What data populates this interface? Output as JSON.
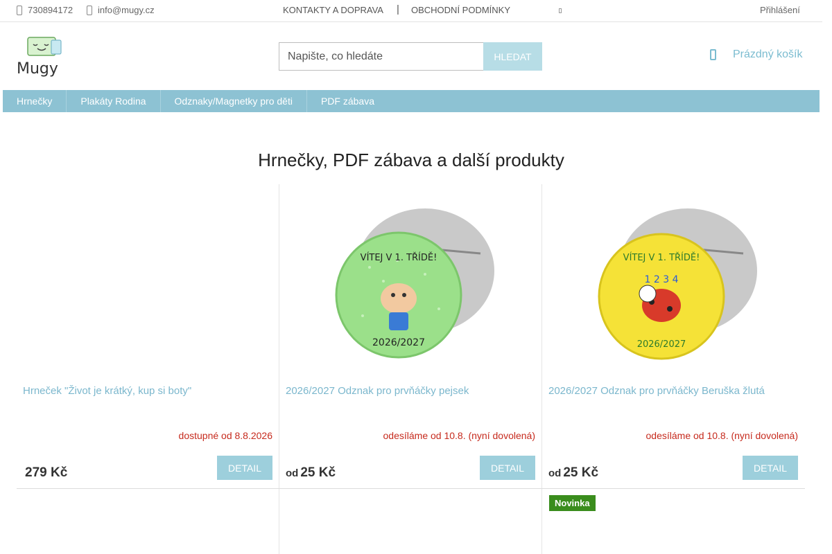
{
  "topbar": {
    "phone": "730894172",
    "email": "info@mugy.cz",
    "links": [
      "KONTAKTY A DOPRAVA",
      "OBCHODNÍ PODMÍNKY"
    ],
    "separator": "|",
    "login": "Přihlášení"
  },
  "header": {
    "logo_text": "Mugy",
    "search_placeholder": "Napište, co hledáte",
    "search_button": "HLEDAT",
    "cart_label": "Prázdný košík"
  },
  "nav": {
    "items": [
      "Hrnečky",
      "Plakáty Rodina",
      "Odznaky/Magnetky pro děti",
      "PDF zábava"
    ]
  },
  "page": {
    "title": "Hrnečky, PDF zábava a další produkty"
  },
  "products": [
    {
      "name": "Hrneček \"Život je krátký, kup si boty\"",
      "availability": "dostupné od 8.8.2026",
      "price_prefix": "",
      "price": "279 Kč",
      "detail": "DETAIL"
    },
    {
      "name": "2026/2027 Odznak pro prvňáčky pejsek",
      "availability": "odesíláme od 10.8. (nyní dovolená)",
      "price_prefix": "od",
      "price": "25 Kč",
      "detail": "DETAIL",
      "badge_text": [
        "VÍTEJ V 1. TŘÍDĚ!",
        "2026/2027"
      ],
      "badge_color": "#9be08a"
    },
    {
      "name": "2026/2027 Odznak pro prvňáčky Beruška žlutá",
      "availability": "odesíláme od 10.8. (nyní dovolená)",
      "price_prefix": "od",
      "price": "25 Kč",
      "detail": "DETAIL",
      "badge_text": [
        "VÍTEJ V 1. TŘÍDĚ!",
        "2026/2027",
        "1 2 3 4"
      ],
      "badge_color": "#f5e237"
    }
  ],
  "next_row": {
    "badge": "Novinka"
  },
  "colors": {
    "accent": "#8dc2d3",
    "link": "#7bb7cd",
    "availability": "#c62a1d",
    "badge_green": "#3a8d1d"
  }
}
